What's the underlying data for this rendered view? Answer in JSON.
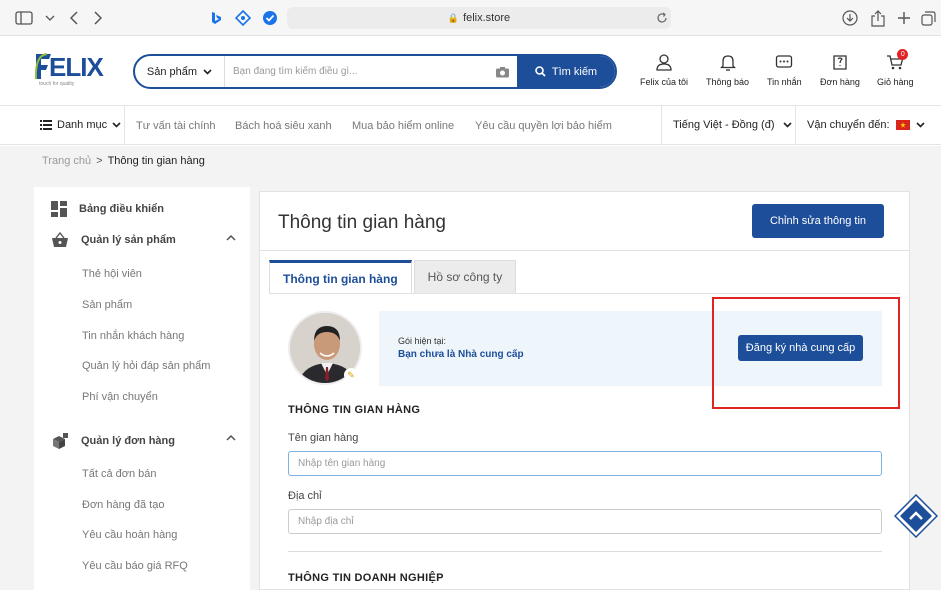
{
  "browser": {
    "url": "felix.store",
    "colors": {
      "accent": "#1d4e9a"
    }
  },
  "header": {
    "logo_text": "ELIX",
    "logo_tagline": "touch for quality",
    "search_category": "Sản phẩm",
    "search_placeholder": "Bạn đang tìm kiếm điều gì...",
    "search_button": "Tìm kiếm",
    "actions": [
      {
        "label": "Felix của tôi",
        "icon": "user-icon"
      },
      {
        "label": "Thông báo",
        "icon": "bell-icon"
      },
      {
        "label": "Tin nhắn",
        "icon": "chat-icon"
      },
      {
        "label": "Đơn hàng",
        "icon": "orders-icon"
      },
      {
        "label": "Giỏ hàng",
        "icon": "cart-icon",
        "badge": "0"
      }
    ]
  },
  "nav": {
    "menu": "Danh mục",
    "links": [
      "Tư vấn tài chính",
      "Bách hoá siêu xanh",
      "Mua bảo hiểm online",
      "Yêu cầu quyền lợi bảo hiểm"
    ],
    "language": "Tiếng Việt - Đồng (đ)",
    "shipping": "Vận chuyển đến:"
  },
  "breadcrumb": {
    "home": "Trang chủ",
    "separator": ">",
    "current": "Thông tin gian hàng"
  },
  "sidebar": {
    "dashboard": "Bảng điều khiển",
    "products_group": "Quản lý sản phẩm",
    "product_items": [
      "Thẻ hội viên",
      "Sản phẩm",
      "Tin nhắn khách hàng",
      "Quản lý hỏi đáp sản phẩm",
      "Phí vận chuyển"
    ],
    "orders_group": "Quản lý đơn hàng",
    "order_items": [
      "Tất cả đơn bán",
      "Đơn hàng đã tạo",
      "Yêu cầu hoàn hàng",
      "Yêu cầu báo giá RFQ"
    ]
  },
  "main": {
    "title": "Thông tin gian hàng",
    "edit_button": "Chỉnh sửa thông tin",
    "tabs": [
      "Thông tin gian hàng",
      "Hồ sơ công ty"
    ],
    "plan_label": "Gói hiện tại:",
    "plan_value": "Bạn chưa là Nhà cung cấp",
    "register_button": "Đăng ký nhà cung cấp",
    "store_section": "THÔNG TIN GIAN HÀNG",
    "store_name_label": "Tên gian hàng",
    "store_name_placeholder": "Nhập tên gian hàng",
    "address_label": "Địa chỉ",
    "address_placeholder": "Nhập địa chỉ",
    "business_section": "THÔNG TIN DOANH NGHIỆP"
  }
}
